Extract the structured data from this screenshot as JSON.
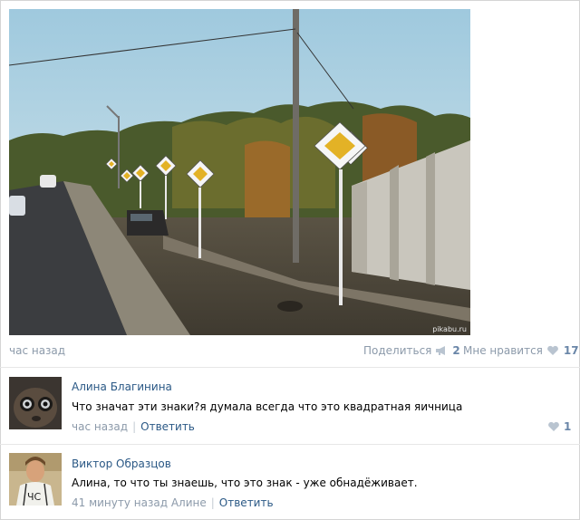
{
  "post": {
    "photo_watermark": "pikabu.ru",
    "time": "час назад",
    "share_label": "Поделиться",
    "share_count": "2",
    "like_label": "Мне нравится",
    "like_count": "17"
  },
  "comments": [
    {
      "author": "Алина Благинина",
      "text": "Что значат эти знаки?я думала всегда что это квадратная яичница",
      "time": "час назад",
      "reply_label": "Ответить",
      "like_count": "1"
    },
    {
      "author": "Виктор Образцов",
      "text": "Алина, то что ты знаешь, что это знак - уже обнадёживает.",
      "time": "41 минуту назад Алине",
      "reply_label": "Ответить"
    }
  ],
  "icons": {
    "share": "megaphone-icon",
    "like": "heart-icon"
  },
  "colors": {
    "link": "#2a5885",
    "muted": "#8c9aaa",
    "count": "#6a86a8",
    "icon": "#b9c4d0"
  }
}
